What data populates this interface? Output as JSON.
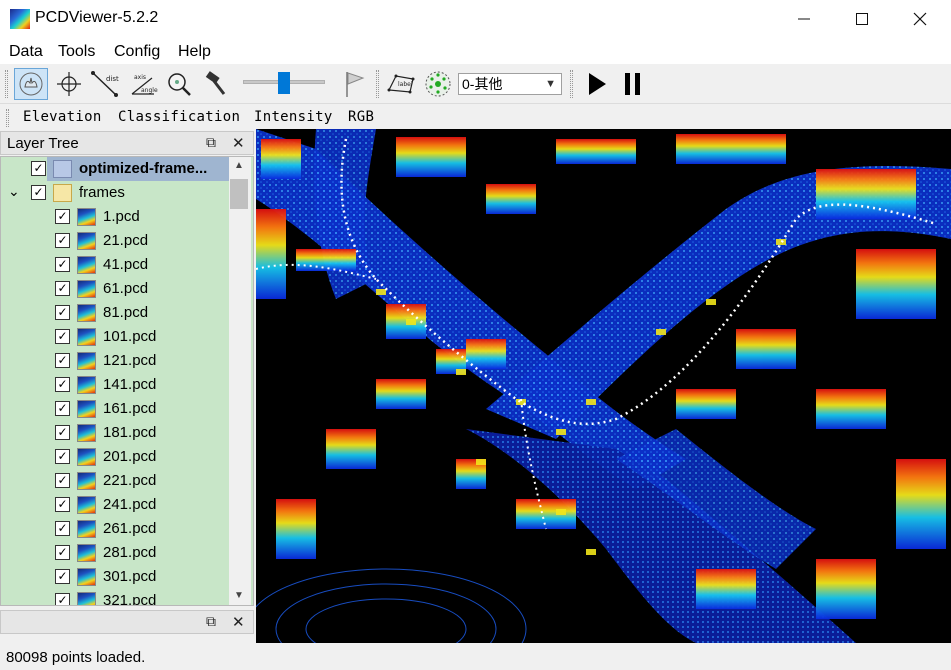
{
  "window": {
    "title": "PCDViewer-5.2.2",
    "controls": [
      "minimize",
      "maximize",
      "close"
    ]
  },
  "menu": [
    "Data",
    "Tools",
    "Config",
    "Help"
  ],
  "toolbar": {
    "tools": [
      "select-icon",
      "crosshair-icon",
      "distance-icon",
      "angle-icon",
      "zoom-icon",
      "hammer-icon"
    ],
    "tool_labels": {
      "distance": "dist",
      "angle_top": "axis",
      "angle_bottom": "angle",
      "label": "label"
    },
    "slider_value": 0.5,
    "class_select": {
      "value": "0-其他"
    },
    "playback": [
      "play-icon",
      "pause-icon"
    ]
  },
  "color_modes": [
    "Elevation",
    "Classification",
    "Intensity",
    "RGB"
  ],
  "layer_tree": {
    "title": "Layer Tree",
    "items": [
      {
        "label": "optimized-frame...",
        "level": 0,
        "checked": true,
        "bold": true,
        "icon": "frame-icon"
      },
      {
        "label": "frames",
        "level": 0,
        "checked": true,
        "bold": false,
        "icon": "folder-icon",
        "expanded": true
      },
      {
        "label": "1.pcd",
        "level": 1,
        "checked": true,
        "icon": "pcd-icon"
      },
      {
        "label": "21.pcd",
        "level": 1,
        "checked": true,
        "icon": "pcd-icon"
      },
      {
        "label": "41.pcd",
        "level": 1,
        "checked": true,
        "icon": "pcd-icon"
      },
      {
        "label": "61.pcd",
        "level": 1,
        "checked": true,
        "icon": "pcd-icon"
      },
      {
        "label": "81.pcd",
        "level": 1,
        "checked": true,
        "icon": "pcd-icon"
      },
      {
        "label": "101.pcd",
        "level": 1,
        "checked": true,
        "icon": "pcd-icon"
      },
      {
        "label": "121.pcd",
        "level": 1,
        "checked": true,
        "icon": "pcd-icon"
      },
      {
        "label": "141.pcd",
        "level": 1,
        "checked": true,
        "icon": "pcd-icon"
      },
      {
        "label": "161.pcd",
        "level": 1,
        "checked": true,
        "icon": "pcd-icon"
      },
      {
        "label": "181.pcd",
        "level": 1,
        "checked": true,
        "icon": "pcd-icon"
      },
      {
        "label": "201.pcd",
        "level": 1,
        "checked": true,
        "icon": "pcd-icon"
      },
      {
        "label": "221.pcd",
        "level": 1,
        "checked": true,
        "icon": "pcd-icon"
      },
      {
        "label": "241.pcd",
        "level": 1,
        "checked": true,
        "icon": "pcd-icon"
      },
      {
        "label": "261.pcd",
        "level": 1,
        "checked": true,
        "icon": "pcd-icon"
      },
      {
        "label": "281.pcd",
        "level": 1,
        "checked": true,
        "icon": "pcd-icon"
      },
      {
        "label": "301.pcd",
        "level": 1,
        "checked": true,
        "icon": "pcd-icon"
      },
      {
        "label": "321.pcd",
        "level": 1,
        "checked": true,
        "icon": "pcd-icon"
      }
    ]
  },
  "status": {
    "text": "80098 points loaded."
  },
  "colors": {
    "tree_bg": "#c8e6c8",
    "accent": "#0078d7",
    "viewport_bg": "#000000"
  }
}
